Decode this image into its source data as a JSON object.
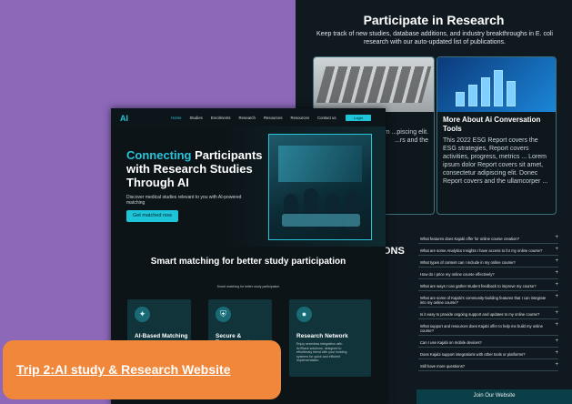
{
  "research_page": {
    "title": "Participate in Research",
    "subtitle": "Keep track of new studies, database additions, and industry breakthroughs in E. coli research with our auto-updated list of publications.",
    "cards": [
      {
        "title": "",
        "body": "...rs the ESG ... Lorem ...piscing elit. ...rs and the"
      },
      {
        "title": "More About Ai Conversation Tools",
        "body": "This 2022 ESG Report covers the ESG strategies, Report covers activities, progress, metrics ... Lorem ipsum dolor Report covers sit amet, consectetur adipiscing elit. Donec Report covers and the ullamcorper ..."
      }
    ],
    "faq_partial_title": "ONS",
    "faq": [
      "What features does Kajabi offer for online course creation?",
      "What are some Analytics Insights I have access to for my online course?",
      "What types of content can I include in my online course?",
      "How do I price my online course effectively?",
      "What are ways I can gather student feedback to improve my course?",
      "What are some of Kajabi's community-building features that I can integrate into my online course?",
      "Is it easy to provide ongoing support and updates to my online course?",
      "What support and resources does Kajabi offer to help me build my online course?",
      "Can I use Kajabi on mobile devices?",
      "Does Kajabi support integrations with other tools or platforms?",
      "Still have more questions?"
    ],
    "footer_label": "Join Our Website"
  },
  "site": {
    "logo": "AI",
    "nav": [
      "Home",
      "Studies",
      "Enrolments",
      "Research",
      "Resources",
      "Resources",
      "Contact us"
    ],
    "login": "Login",
    "hero": {
      "title_accent": "Connecting",
      "title_rest": " Participants with Research Studies Through AI",
      "subtitle": "Discover medical studies relevant to you with AI-powered matching",
      "cta": "Get matched now"
    },
    "smart_title": "Smart matching for better study participation",
    "smart_sub": "Smart matching for better study participation",
    "features": [
      {
        "icon": "ai-icon",
        "glyph": "✦",
        "title": "AI-Based Matching",
        "body": ""
      },
      {
        "icon": "shield-icon",
        "glyph": "⛨",
        "title": "Secure & Transparent",
        "body": ""
      },
      {
        "icon": "person-icon",
        "glyph": "●",
        "title": "Research Network",
        "body": "Enjoy seamless integration with ArtStack solutions, designed to effortlessly blend with your existing systems for quick and efficient implementation."
      }
    ]
  },
  "badge": "Trip 2:AI study & Research Website",
  "colors": {
    "accent": "#27c3d9",
    "badge": "#f1873a",
    "background": "#8d68b9"
  }
}
